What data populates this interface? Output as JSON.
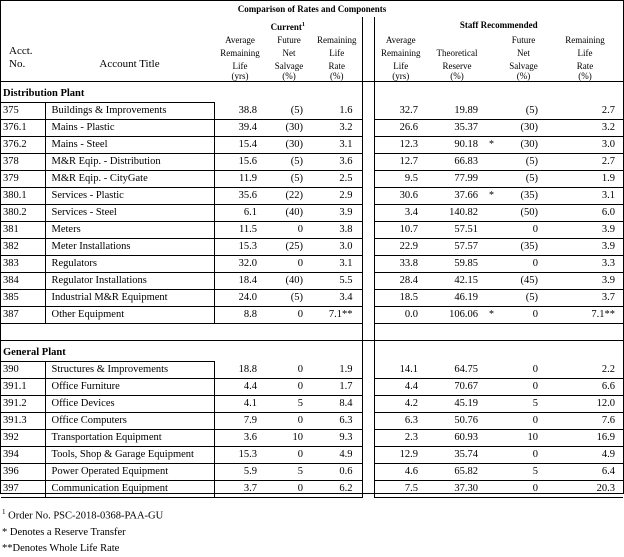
{
  "header": {
    "title": "Comparison of Rates and Components",
    "current_label": "Current",
    "current_note": "1",
    "staff_label": "Staff Recommended",
    "acct_no": [
      "Acct.",
      "No."
    ],
    "account_title": "Account Title",
    "current_cols": [
      [
        "Average",
        "Remaining",
        "Life",
        "(yrs)"
      ],
      [
        "Future",
        "Net",
        "Salvage",
        "(%)"
      ],
      [
        "Remaining",
        "Life",
        "Rate",
        "(%)"
      ]
    ],
    "staff_cols": [
      [
        "Average",
        "Remaining",
        "Life",
        "(yrs)"
      ],
      [
        "",
        "Theoretical",
        "Reserve",
        "(%)"
      ],
      [
        "Future",
        "Net",
        "Salvage",
        "(%)"
      ],
      [
        "Remaining",
        "Life",
        "Rate",
        "(%)"
      ]
    ]
  },
  "sections": [
    {
      "name": "Distribution Plant",
      "rows": [
        {
          "acct": "375",
          "title": "Buildings & Improvements",
          "c_life": "38.8",
          "c_salv": "(5)",
          "c_rate": "1.6",
          "s_life": "32.7",
          "s_res": "19.89",
          "mark": "",
          "s_salv": "(5)",
          "s_rate": "2.7"
        },
        {
          "acct": "376.1",
          "title": "Mains - Plastic",
          "c_life": "39.4",
          "c_salv": "(30)",
          "c_rate": "3.2",
          "s_life": "26.6",
          "s_res": "35.37",
          "mark": "",
          "s_salv": "(30)",
          "s_rate": "3.2"
        },
        {
          "acct": "376.2",
          "title": "Mains - Steel",
          "c_life": "15.4",
          "c_salv": "(30)",
          "c_rate": "3.1",
          "s_life": "12.3",
          "s_res": "90.18",
          "mark": "*",
          "s_salv": "(30)",
          "s_rate": "3.0"
        },
        {
          "acct": "378",
          "title": "M&R Eqip. - Distribution",
          "c_life": "15.6",
          "c_salv": "(5)",
          "c_rate": "3.6",
          "s_life": "12.7",
          "s_res": "66.83",
          "mark": "",
          "s_salv": "(5)",
          "s_rate": "2.7"
        },
        {
          "acct": "379",
          "title": "M&R Eqip. - CityGate",
          "c_life": "11.9",
          "c_salv": "(5)",
          "c_rate": "2.5",
          "s_life": "9.5",
          "s_res": "77.99",
          "mark": "",
          "s_salv": "(5)",
          "s_rate": "1.9"
        },
        {
          "acct": "380.1",
          "title": "Services - Plastic",
          "c_life": "35.6",
          "c_salv": "(22)",
          "c_rate": "2.9",
          "s_life": "30.6",
          "s_res": "37.66",
          "mark": "*",
          "s_salv": "(35)",
          "s_rate": "3.1"
        },
        {
          "acct": "380.2",
          "title": "Services - Steel",
          "c_life": "6.1",
          "c_salv": "(40)",
          "c_rate": "3.9",
          "s_life": "3.4",
          "s_res": "140.82",
          "mark": "",
          "s_salv": "(50)",
          "s_rate": "6.0"
        },
        {
          "acct": "381",
          "title": "Meters",
          "c_life": "11.5",
          "c_salv": "0",
          "c_rate": "3.8",
          "s_life": "10.7",
          "s_res": "57.51",
          "mark": "",
          "s_salv": "0",
          "s_rate": "3.9"
        },
        {
          "acct": "382",
          "title": "Meter Installations",
          "c_life": "15.3",
          "c_salv": "(25)",
          "c_rate": "3.0",
          "s_life": "22.9",
          "s_res": "57.57",
          "mark": "",
          "s_salv": "(35)",
          "s_rate": "3.9"
        },
        {
          "acct": "383",
          "title": "Regulators",
          "c_life": "32.0",
          "c_salv": "0",
          "c_rate": "3.1",
          "s_life": "33.8",
          "s_res": "59.85",
          "mark": "",
          "s_salv": "0",
          "s_rate": "3.3"
        },
        {
          "acct": "384",
          "title": "Regulator Installations",
          "c_life": "18.4",
          "c_salv": "(40)",
          "c_rate": "5.5",
          "s_life": "28.4",
          "s_res": "42.15",
          "mark": "",
          "s_salv": "(45)",
          "s_rate": "3.9"
        },
        {
          "acct": "385",
          "title": "Industrial M&R Equipment",
          "c_life": "24.0",
          "c_salv": "(5)",
          "c_rate": "3.4",
          "s_life": "18.5",
          "s_res": "46.19",
          "mark": "",
          "s_salv": "(5)",
          "s_rate": "3.7"
        },
        {
          "acct": "387",
          "title": "Other Equipment",
          "c_life": "8.8",
          "c_salv": "0",
          "c_rate": "7.1**",
          "s_life": "0.0",
          "s_res": "106.06",
          "mark": "*",
          "s_salv": "0",
          "s_rate": "7.1**"
        }
      ]
    },
    {
      "name": "General Plant",
      "rows": [
        {
          "acct": "390",
          "title": "Structures & Improvements",
          "c_life": "18.8",
          "c_salv": "0",
          "c_rate": "1.9",
          "s_life": "14.1",
          "s_res": "64.75",
          "mark": "",
          "s_salv": "0",
          "s_rate": "2.2"
        },
        {
          "acct": "391.1",
          "title": "Office Furniture",
          "c_life": "4.4",
          "c_salv": "0",
          "c_rate": "1.7",
          "s_life": "4.4",
          "s_res": "70.67",
          "mark": "",
          "s_salv": "0",
          "s_rate": "6.6"
        },
        {
          "acct": "391.2",
          "title": "Office Devices",
          "c_life": "4.1",
          "c_salv": "5",
          "c_rate": "8.4",
          "s_life": "4.2",
          "s_res": "45.19",
          "mark": "",
          "s_salv": "5",
          "s_rate": "12.0"
        },
        {
          "acct": "391.3",
          "title": "Office Computers",
          "c_life": "7.9",
          "c_salv": "0",
          "c_rate": "6.3",
          "s_life": "6.3",
          "s_res": "50.76",
          "mark": "",
          "s_salv": "0",
          "s_rate": "7.6"
        },
        {
          "acct": "392",
          "title": "Transportation Equipment",
          "c_life": "3.6",
          "c_salv": "10",
          "c_rate": "9.3",
          "s_life": "2.3",
          "s_res": "60.93",
          "mark": "",
          "s_salv": "10",
          "s_rate": "16.9"
        },
        {
          "acct": "394",
          "title": "Tools, Shop & Garage Equipment",
          "c_life": "15.3",
          "c_salv": "0",
          "c_rate": "4.9",
          "s_life": "12.9",
          "s_res": "35.74",
          "mark": "",
          "s_salv": "0",
          "s_rate": "4.9"
        },
        {
          "acct": "396",
          "title": "Power Operated Equipment",
          "c_life": "5.9",
          "c_salv": "5",
          "c_rate": "0.6",
          "s_life": "4.6",
          "s_res": "65.82",
          "mark": "",
          "s_salv": "5",
          "s_rate": "6.4"
        },
        {
          "acct": "397",
          "title": "Communication Equipment",
          "c_life": "3.7",
          "c_salv": "0",
          "c_rate": "6.2",
          "s_life": "7.5",
          "s_res": "37.30",
          "mark": "",
          "s_salv": "0",
          "s_rate": "20.3"
        }
      ]
    }
  ],
  "footnotes": {
    "note1_marker": "1",
    "note1_text": "Order No. PSC-2018-0368-PAA-GU",
    "note2": "* Denotes a Reserve Transfer",
    "note3": "**Denotes Whole Life Rate"
  }
}
